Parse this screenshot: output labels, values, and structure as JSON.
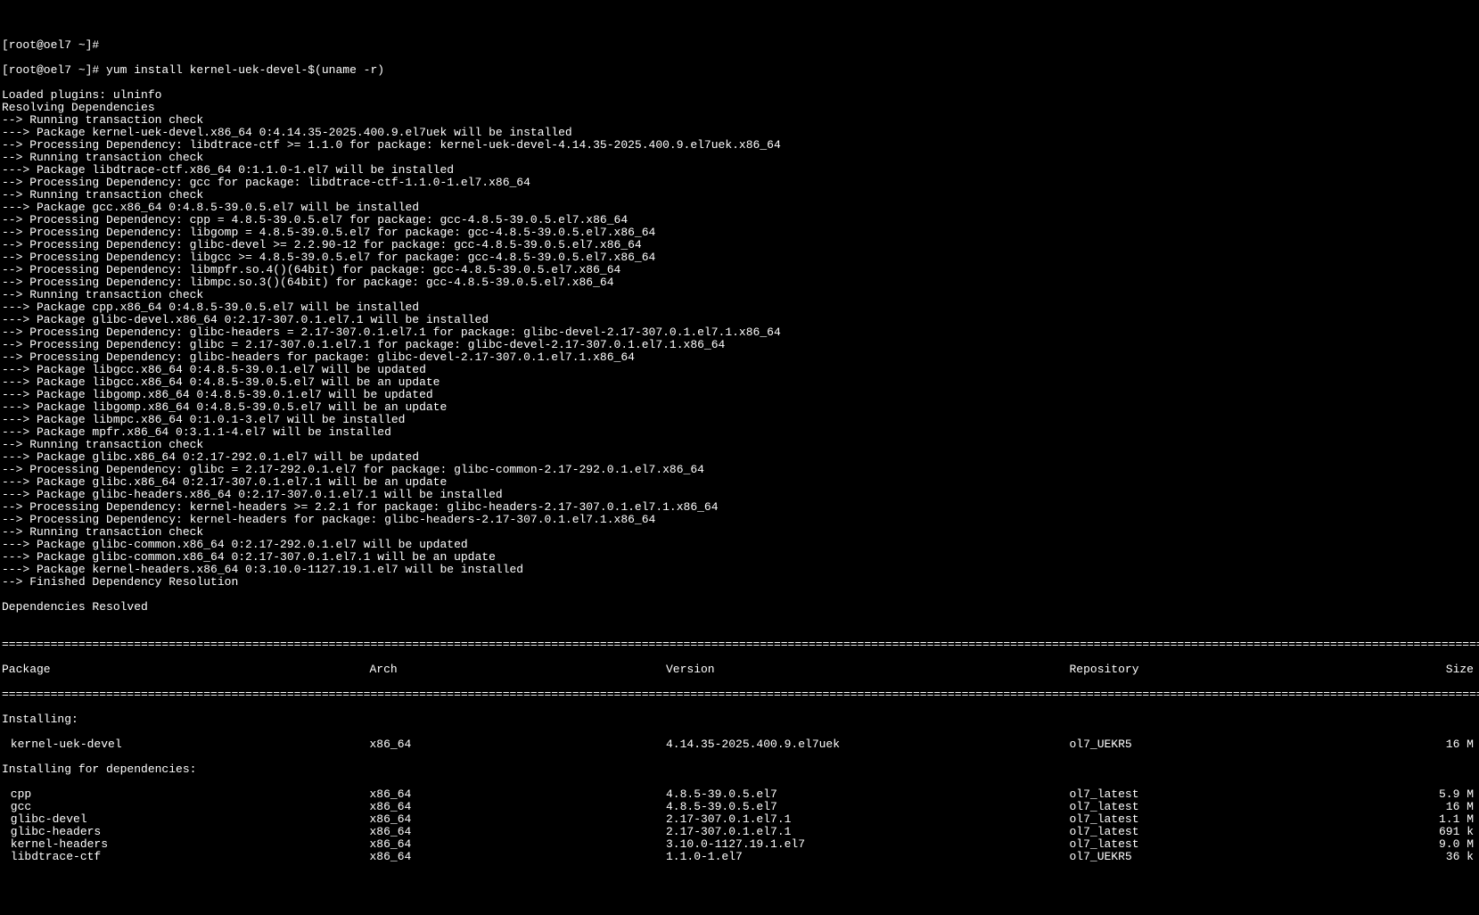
{
  "prompt1": "[root@oel7 ~]#",
  "prompt2": "[root@oel7 ~]# yum install kernel-uek-devel-$(uname -r)",
  "lines": [
    "Loaded plugins: ulninfo",
    "Resolving Dependencies",
    "--> Running transaction check",
    "---> Package kernel-uek-devel.x86_64 0:4.14.35-2025.400.9.el7uek will be installed",
    "--> Processing Dependency: libdtrace-ctf >= 1.1.0 for package: kernel-uek-devel-4.14.35-2025.400.9.el7uek.x86_64",
    "--> Running transaction check",
    "---> Package libdtrace-ctf.x86_64 0:1.1.0-1.el7 will be installed",
    "--> Processing Dependency: gcc for package: libdtrace-ctf-1.1.0-1.el7.x86_64",
    "--> Running transaction check",
    "---> Package gcc.x86_64 0:4.8.5-39.0.5.el7 will be installed",
    "--> Processing Dependency: cpp = 4.8.5-39.0.5.el7 for package: gcc-4.8.5-39.0.5.el7.x86_64",
    "--> Processing Dependency: libgomp = 4.8.5-39.0.5.el7 for package: gcc-4.8.5-39.0.5.el7.x86_64",
    "--> Processing Dependency: glibc-devel >= 2.2.90-12 for package: gcc-4.8.5-39.0.5.el7.x86_64",
    "--> Processing Dependency: libgcc >= 4.8.5-39.0.5.el7 for package: gcc-4.8.5-39.0.5.el7.x86_64",
    "--> Processing Dependency: libmpfr.so.4()(64bit) for package: gcc-4.8.5-39.0.5.el7.x86_64",
    "--> Processing Dependency: libmpc.so.3()(64bit) for package: gcc-4.8.5-39.0.5.el7.x86_64",
    "--> Running transaction check",
    "---> Package cpp.x86_64 0:4.8.5-39.0.5.el7 will be installed",
    "---> Package glibc-devel.x86_64 0:2.17-307.0.1.el7.1 will be installed",
    "--> Processing Dependency: glibc-headers = 2.17-307.0.1.el7.1 for package: glibc-devel-2.17-307.0.1.el7.1.x86_64",
    "--> Processing Dependency: glibc = 2.17-307.0.1.el7.1 for package: glibc-devel-2.17-307.0.1.el7.1.x86_64",
    "--> Processing Dependency: glibc-headers for package: glibc-devel-2.17-307.0.1.el7.1.x86_64",
    "---> Package libgcc.x86_64 0:4.8.5-39.0.1.el7 will be updated",
    "---> Package libgcc.x86_64 0:4.8.5-39.0.5.el7 will be an update",
    "---> Package libgomp.x86_64 0:4.8.5-39.0.1.el7 will be updated",
    "---> Package libgomp.x86_64 0:4.8.5-39.0.5.el7 will be an update",
    "---> Package libmpc.x86_64 0:1.0.1-3.el7 will be installed",
    "---> Package mpfr.x86_64 0:3.1.1-4.el7 will be installed",
    "--> Running transaction check",
    "---> Package glibc.x86_64 0:2.17-292.0.1.el7 will be updated",
    "--> Processing Dependency: glibc = 2.17-292.0.1.el7 for package: glibc-common-2.17-292.0.1.el7.x86_64",
    "---> Package glibc.x86_64 0:2.17-307.0.1.el7.1 will be an update",
    "---> Package glibc-headers.x86_64 0:2.17-307.0.1.el7.1 will be installed",
    "--> Processing Dependency: kernel-headers >= 2.2.1 for package: glibc-headers-2.17-307.0.1.el7.1.x86_64",
    "--> Processing Dependency: kernel-headers for package: glibc-headers-2.17-307.0.1.el7.1.x86_64",
    "--> Running transaction check",
    "---> Package glibc-common.x86_64 0:2.17-292.0.1.el7 will be updated",
    "---> Package glibc-common.x86_64 0:2.17-307.0.1.el7.1 will be an update",
    "---> Package kernel-headers.x86_64 0:3.10.0-1127.19.1.el7 will be installed",
    "--> Finished Dependency Resolution",
    "",
    "Dependencies Resolved",
    ""
  ],
  "sep": "===========================================================================================================================================================================================================================",
  "header": {
    "c1": "Package",
    "c2": "Arch",
    "c3": "Version",
    "c4": "Repository",
    "c5": "Size"
  },
  "section1": "Installing:",
  "row0": {
    "c1": " kernel-uek-devel",
    "c2": "x86_64",
    "c3": "4.14.35-2025.400.9.el7uek",
    "c4": "ol7_UEKR5",
    "c5": "16 M"
  },
  "section2": "Installing for dependencies:",
  "rows": [
    {
      "c1": " cpp",
      "c2": "x86_64",
      "c3": "4.8.5-39.0.5.el7",
      "c4": "ol7_latest",
      "c5": "5.9 M"
    },
    {
      "c1": " gcc",
      "c2": "x86_64",
      "c3": "4.8.5-39.0.5.el7",
      "c4": "ol7_latest",
      "c5": "16 M"
    },
    {
      "c1": " glibc-devel",
      "c2": "x86_64",
      "c3": "2.17-307.0.1.el7.1",
      "c4": "ol7_latest",
      "c5": "1.1 M"
    },
    {
      "c1": " glibc-headers",
      "c2": "x86_64",
      "c3": "2.17-307.0.1.el7.1",
      "c4": "ol7_latest",
      "c5": "691 k"
    },
    {
      "c1": " kernel-headers",
      "c2": "x86_64",
      "c3": "3.10.0-1127.19.1.el7",
      "c4": "ol7_latest",
      "c5": "9.0 M"
    },
    {
      "c1": " libdtrace-ctf",
      "c2": "x86_64",
      "c3": "1.1.0-1.el7",
      "c4": "ol7_UEKR5",
      "c5": "36 k"
    }
  ]
}
